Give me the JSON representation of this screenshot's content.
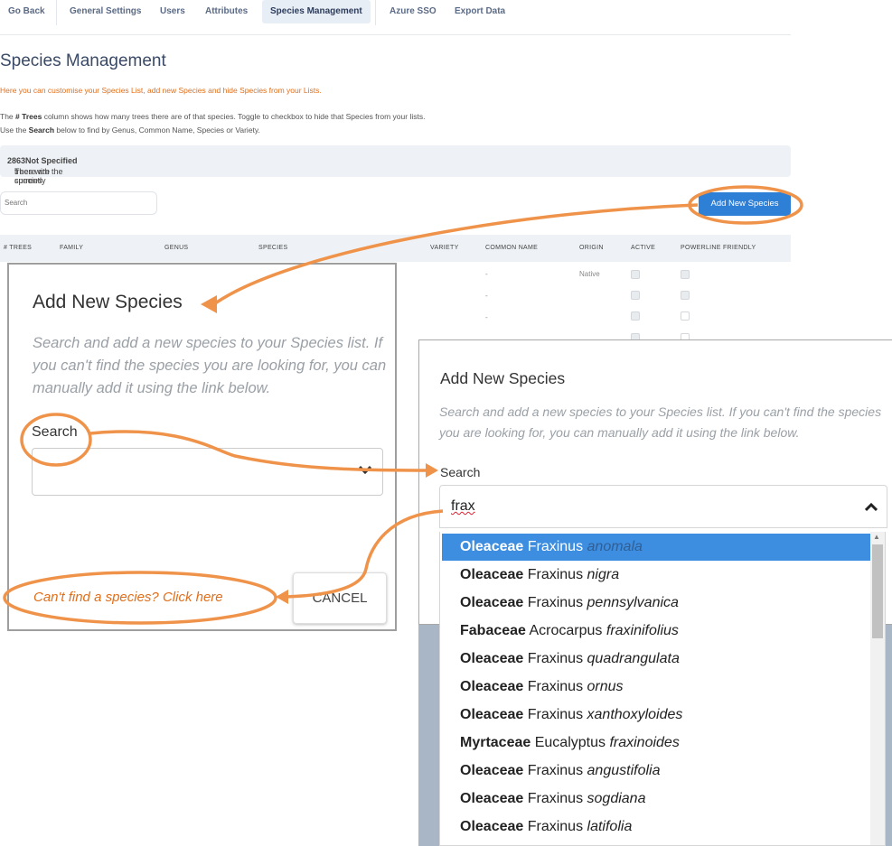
{
  "nav": {
    "tabs": [
      "Go Back",
      "General Settings",
      "Users",
      "Attributes",
      "Species Management",
      "Azure SSO",
      "Export Data"
    ],
    "active": "Species Management"
  },
  "page": {
    "title": "Species Management",
    "intro": "Here you can customise your Species List, add new Species and hide Species from your Lists.",
    "desc1_a": "The ",
    "desc1_b": "# Trees",
    "desc1_c": " column shows how many trees there are of that species. Toggle to checkbox to hide that Species from your lists.",
    "desc2_a": "Use the ",
    "desc2_b": "Search",
    "desc2_c": " below to find by Genus, Common Name, Species or Variety.",
    "banner_a": "There are currently ",
    "banner_count": "2863",
    "banner_b": " trees with the species ",
    "banner_species": "Not Specified",
    "banner_c": ".",
    "search_placeholder": "Search",
    "add_button": "Add New Species"
  },
  "table": {
    "headers": [
      "# TREES",
      "FAMILY",
      "GENUS",
      "SPECIES",
      "VARIETY",
      "COMMON NAME",
      "ORIGIN",
      "ACTIVE",
      "POWERLINE FRIENDLY"
    ],
    "rows": [
      {
        "common": "-",
        "origin": "Native",
        "active": true,
        "powerline": true
      },
      {
        "common": "-",
        "origin": "",
        "active": true,
        "powerline": true
      },
      {
        "common": "-",
        "origin": "",
        "active": true,
        "powerline": false
      }
    ]
  },
  "modal_small": {
    "title": "Add New Species",
    "subtitle": "Search and add a new species to your Species list. If you can't find the species you are looking for, you can manually add it using the link below.",
    "search_label": "Search",
    "link": "Can't find a species? Click here",
    "cancel": "CANCEL"
  },
  "modal_large": {
    "title": "Add New Species",
    "subtitle": "Search and add a new species to your Species list. If you can't find the species you are looking for, you can manually add it using the link below.",
    "search_label": "Search",
    "query": "frax",
    "options": [
      {
        "family": "Oleaceae",
        "genus": "Fraxinus",
        "species": "anomala"
      },
      {
        "family": "Oleaceae",
        "genus": "Fraxinus",
        "species": "nigra"
      },
      {
        "family": "Oleaceae",
        "genus": "Fraxinus",
        "species": "pennsylvanica"
      },
      {
        "family": "Fabaceae",
        "genus": "Acrocarpus",
        "species": "fraxinifolius"
      },
      {
        "family": "Oleaceae",
        "genus": "Fraxinus",
        "species": "quadrangulata"
      },
      {
        "family": "Oleaceae",
        "genus": "Fraxinus",
        "species": "ornus"
      },
      {
        "family": "Oleaceae",
        "genus": "Fraxinus",
        "species": "xanthoxyloides"
      },
      {
        "family": "Myrtaceae",
        "genus": "Eucalyptus",
        "species": "fraxinoides"
      },
      {
        "family": "Oleaceae",
        "genus": "Fraxinus",
        "species": "angustifolia"
      },
      {
        "family": "Oleaceae",
        "genus": "Fraxinus",
        "species": "sogdiana"
      },
      {
        "family": "Oleaceae",
        "genus": "Fraxinus",
        "species": "latifolia"
      }
    ]
  },
  "colors": {
    "accent": "#2e7fd6",
    "annotation": "#f0934a",
    "highlight": "#3d8ee0"
  }
}
